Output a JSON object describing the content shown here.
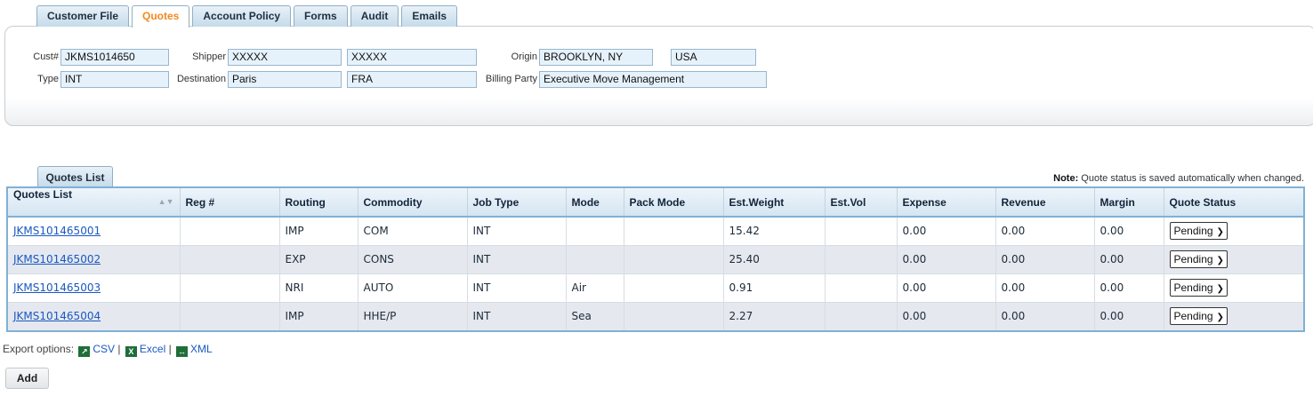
{
  "tabs": [
    "Customer File",
    "Quotes",
    "Account Policy",
    "Forms",
    "Audit",
    "Emails"
  ],
  "active_tab": "Quotes",
  "customer": {
    "cust_label": "Cust#",
    "cust_value": "JKMS1014650",
    "shipper_label": "Shipper",
    "shipper_value": "XXXXX",
    "shipper_value2": "XXXXX",
    "origin_label": "Origin",
    "origin_value": "BROOKLYN, NY",
    "origin_country": "USA",
    "type_label": "Type",
    "type_value": "INT",
    "destination_label": "Destination",
    "destination_value": "Paris",
    "destination_country": "FRA",
    "billing_label": "Billing Party",
    "billing_value": "Executive Move Management"
  },
  "quotes_tab_label": "Quotes List",
  "note_label": "Note:",
  "note_text": "Quote status is saved automatically when changed.",
  "columns": [
    "Quotes List",
    "Reg #",
    "Routing",
    "Commodity",
    "Job Type",
    "Mode",
    "Pack Mode",
    "Est.Weight",
    "Est.Vol",
    "Expense",
    "Revenue",
    "Margin",
    "Quote Status"
  ],
  "rows": [
    {
      "quote": "JKMS101465001",
      "reg": "",
      "routing": "IMP",
      "commodity": "COM",
      "job_type": "INT",
      "mode": "",
      "pack_mode": "",
      "est_weight": "15.42",
      "est_vol": "",
      "expense": "0.00",
      "revenue": "0.00",
      "margin": "0.00",
      "status": "Pending"
    },
    {
      "quote": "JKMS101465002",
      "reg": "",
      "routing": "EXP",
      "commodity": "CONS",
      "job_type": "INT",
      "mode": "",
      "pack_mode": "",
      "est_weight": "25.40",
      "est_vol": "",
      "expense": "0.00",
      "revenue": "0.00",
      "margin": "0.00",
      "status": "Pending"
    },
    {
      "quote": "JKMS101465003",
      "reg": "",
      "routing": "NRI",
      "commodity": "AUTO",
      "job_type": "INT",
      "mode": "Air",
      "pack_mode": "",
      "est_weight": "0.91",
      "est_vol": "",
      "expense": "0.00",
      "revenue": "0.00",
      "margin": "0.00",
      "status": "Pending"
    },
    {
      "quote": "JKMS101465004",
      "reg": "",
      "routing": "IMP",
      "commodity": "HHE/P",
      "job_type": "INT",
      "mode": "Sea",
      "pack_mode": "",
      "est_weight": "2.27",
      "est_vol": "",
      "expense": "0.00",
      "revenue": "0.00",
      "margin": "0.00",
      "status": "Pending"
    }
  ],
  "export": {
    "label": "Export options:",
    "csv": "CSV",
    "excel": "Excel",
    "xml": "XML",
    "separator": "|"
  },
  "add_label": "Add",
  "colors": {
    "active_tab": "#f08a1e",
    "link": "#1a58c2",
    "grid_border": "#7fb1d6",
    "field_bg": "#e6f2fb",
    "alt_row": "#e5e8ef"
  },
  "icons": [
    "sort-icon",
    "csv-icon",
    "excel-icon",
    "xml-icon",
    "chevron-down-icon"
  ]
}
